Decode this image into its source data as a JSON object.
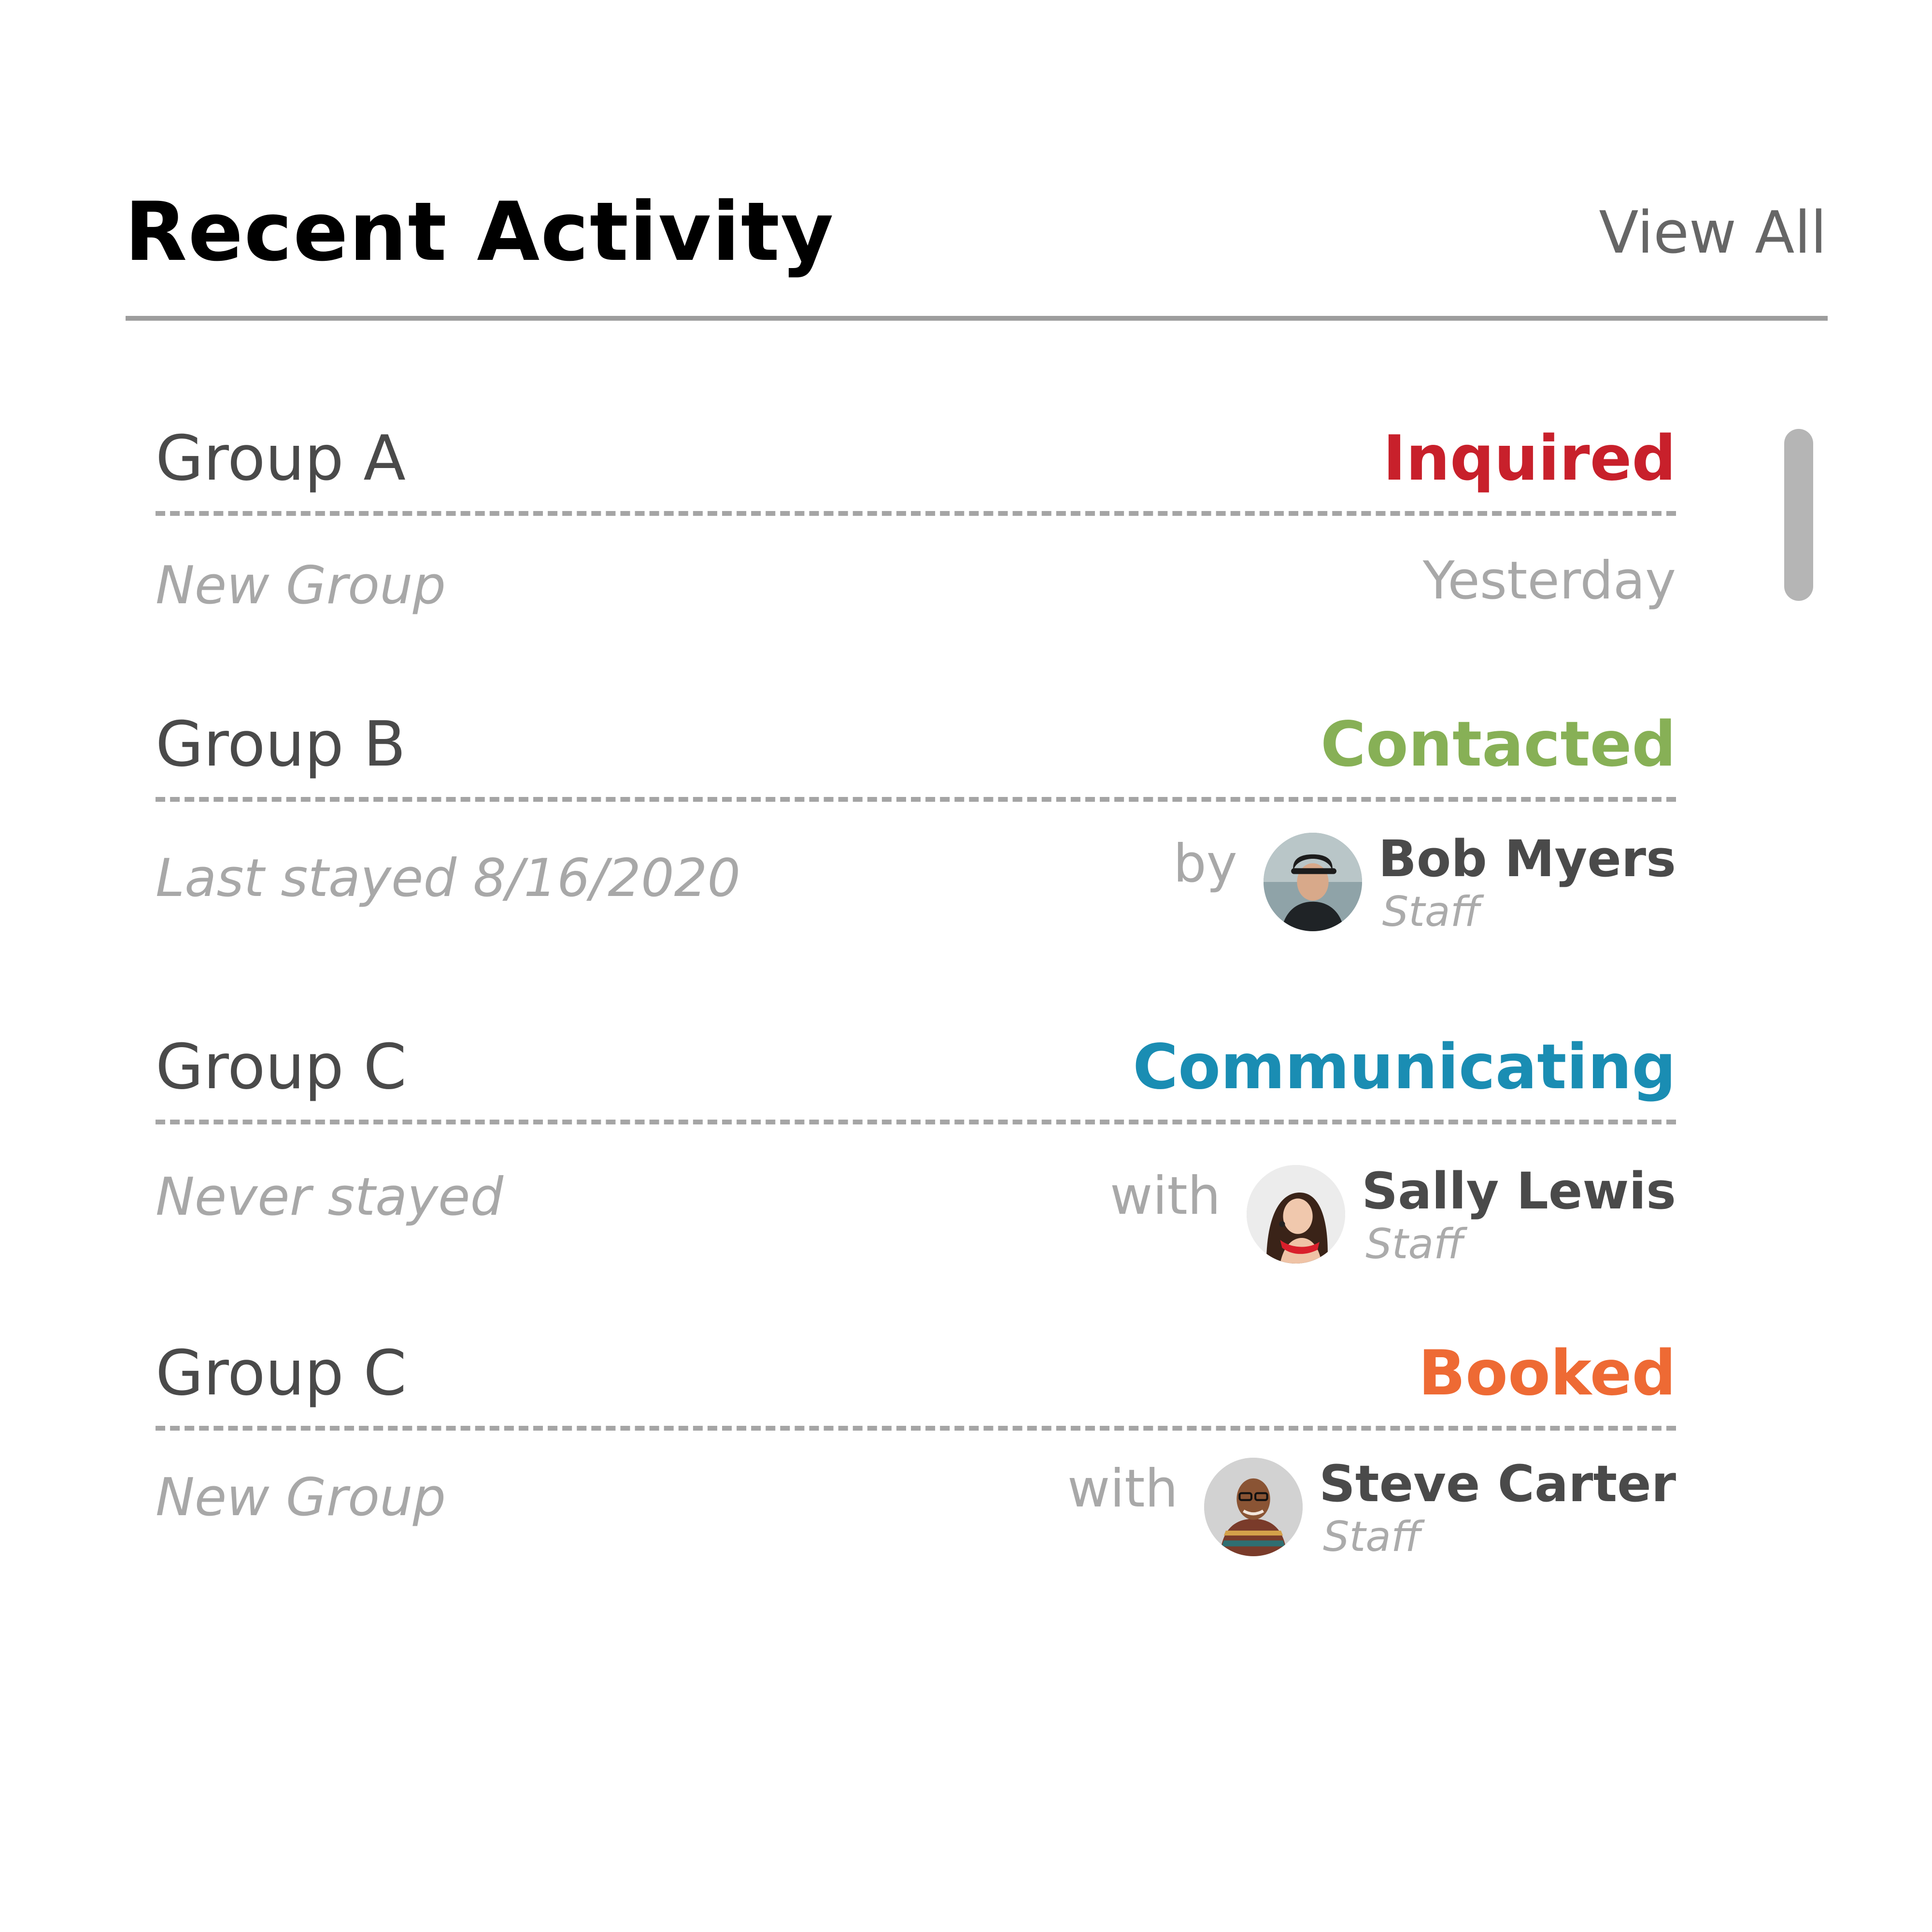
{
  "header": {
    "title": "Recent Activity",
    "view_all_label": "View All"
  },
  "activities": [
    {
      "group": "Group A",
      "status": "Inquired",
      "status_color": "#c8202b",
      "detail": "New Group",
      "when": "Yesterday"
    },
    {
      "group": "Group B",
      "status": "Contacted",
      "status_color": "#87b056",
      "detail": "Last stayed 8/16/2020",
      "preposition": "by",
      "staff": {
        "name": "Bob Myers",
        "role": "Staff",
        "avatar_icon": "bob-myers-avatar"
      }
    },
    {
      "group": "Group C",
      "status": "Communicating",
      "status_color": "#1a8db3",
      "detail": "Never stayed",
      "preposition": "with",
      "staff": {
        "name": "Sally Lewis",
        "role": "Staff",
        "avatar_icon": "sally-lewis-avatar"
      }
    },
    {
      "group": "Group C",
      "status": "Booked",
      "status_color": "#ee6a34",
      "detail": "New Group",
      "preposition": "with",
      "staff": {
        "name": "Steve Carter",
        "role": "Staff",
        "avatar_icon": "steve-carter-avatar"
      }
    }
  ],
  "colors": {
    "text_primary": "#4a4a4a",
    "text_muted": "#a8a8a8",
    "divider": "#9d9d9d",
    "scrollbar": "#b5b5b5"
  }
}
